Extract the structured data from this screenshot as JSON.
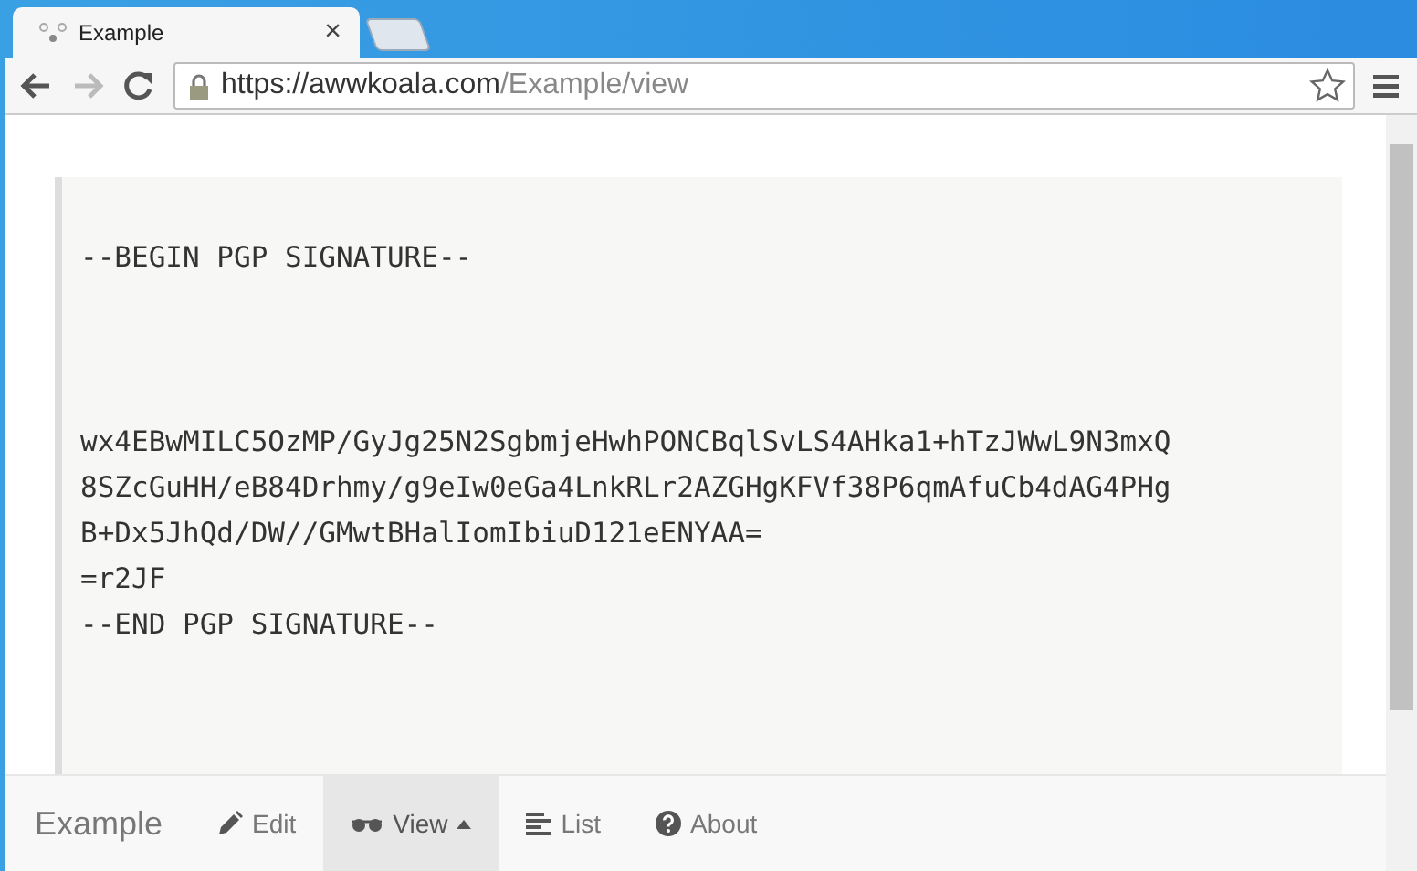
{
  "browser": {
    "tab": {
      "title": "Example",
      "close": "×"
    },
    "back_disabled": false,
    "forward_disabled": true,
    "url": {
      "host": "https://awwkoala.com",
      "path": "/Example/view"
    }
  },
  "signature": {
    "header": "--BEGIN PGP SIGNATURE--",
    "body": [
      "wx4EBwMILC5OzMP/GyJg25N2SgbmjeHwhPONCBqlSvLS4AHka1+hTzJWwL9N3mxQ",
      "8SZcGuHH/eB84Drhmy/g9eIw0eGa4LnkRLr2AZGHgKFVf38P6qmAfuCb4dAG4PHg",
      "B+Dx5JhQd/DW//GMwtBHalIomIbiuD121eENYAA=",
      "=r2JF"
    ],
    "footer": "--END PGP SIGNATURE--"
  },
  "navbar": {
    "brand": "Example",
    "items": [
      {
        "label": "Edit",
        "kind": "pencil",
        "selected": false,
        "dropdown": false
      },
      {
        "label": "View",
        "kind": "glasses",
        "selected": true,
        "dropdown": true
      },
      {
        "label": "List",
        "kind": "list",
        "selected": false,
        "dropdown": false
      },
      {
        "label": "About",
        "kind": "question",
        "selected": false,
        "dropdown": false
      }
    ]
  }
}
